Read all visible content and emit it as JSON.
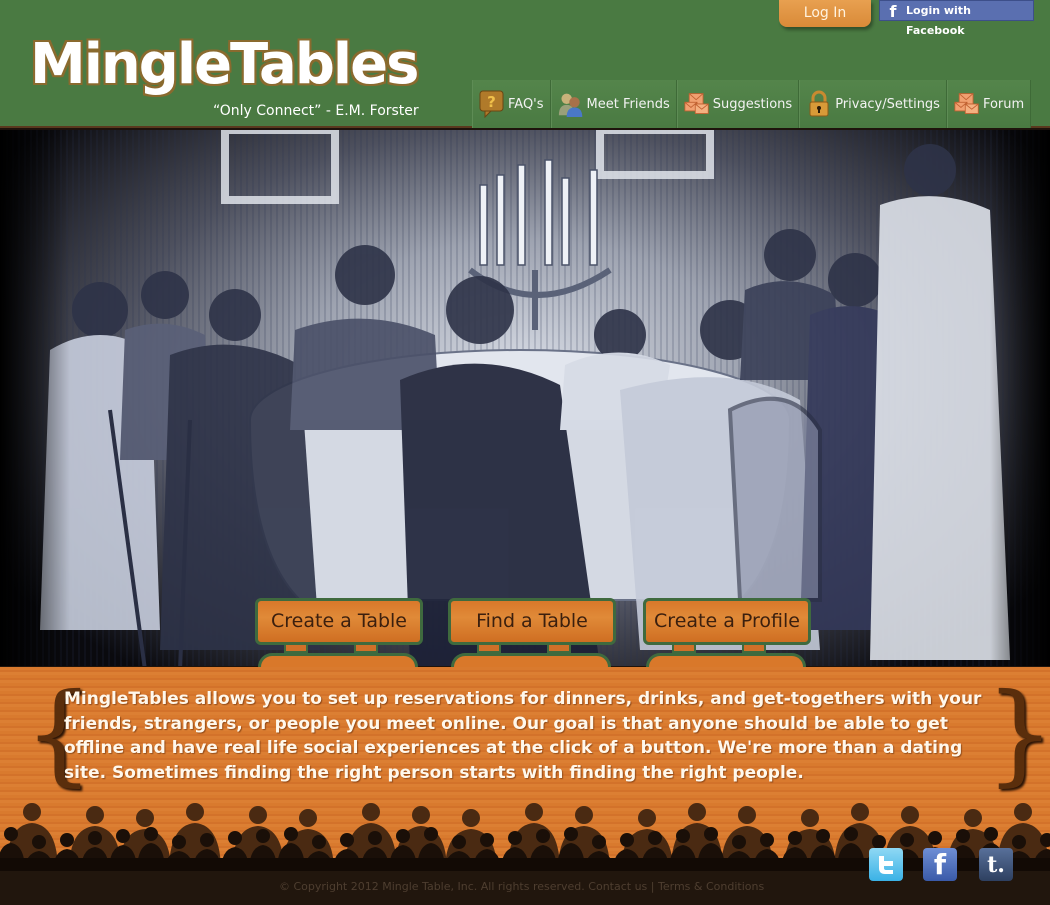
{
  "header": {
    "logo": "MingleTables",
    "tagline": "“Only Connect” - E.M. Forster",
    "login_label": "Log In",
    "facebook_login_label": "Login with Facebook"
  },
  "nav": {
    "items": [
      {
        "label": "FAQ's",
        "icon": "question-bubble-icon"
      },
      {
        "label": "Meet Friends",
        "icon": "people-icon"
      },
      {
        "label": "Suggestions",
        "icon": "envelopes-icon"
      },
      {
        "label": "Privacy/Settings",
        "icon": "padlock-icon"
      },
      {
        "label": "Forum",
        "icon": "envelopes-icon"
      }
    ]
  },
  "hero": {
    "image_description": "Victorian engraving of a dinner party around a candlelit table",
    "buttons": [
      {
        "label": "Create a Table"
      },
      {
        "label": "Find a Table"
      },
      {
        "label": "Create a Profile"
      }
    ]
  },
  "about": {
    "lines": [
      "MingleTables allows you to set up reservations for dinners, drinks, and get-togethers with your",
      "friends, strangers, or people you meet online. Our goal is that anyone should be able to get",
      "offline and have real life social experiences at the click of a button. We're more than a dating",
      "site. Sometimes finding the right person starts with finding the right people."
    ]
  },
  "footer": {
    "copyright": "© Copyright 2012 Mingle Table, Inc. All rights reserved.",
    "contact_label": "Contact us",
    "separator": "|",
    "terms_label": "Terms & Conditions"
  },
  "social": {
    "twitter": "t",
    "facebook": "f",
    "tumblr": "t."
  },
  "colors": {
    "header_green": "#4a7a42",
    "button_orange": "#d9782a",
    "footer_brown": "#21160d",
    "facebook_blue": "#5a6fb0"
  }
}
